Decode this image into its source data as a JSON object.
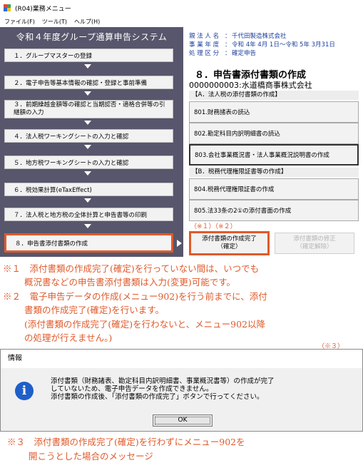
{
  "window": {
    "title": "(R04)業務メニュー",
    "icon_colors": [
      "#e0463a",
      "#3ea14a",
      "#2a6fd0",
      "#f2c21b"
    ]
  },
  "menubar": [
    "ファイル(F)",
    "ツール(T)",
    "ヘルプ(H)"
  ],
  "left_panel": {
    "title": "令和４年度グループ通算申告システム",
    "steps": [
      {
        "label": "１．グループマスターの登録"
      },
      {
        "label": "２．電子申告等基本情報の確認・登録と事前準備"
      },
      {
        "label": "３．前期繰越金額等の確認と当期認否・適格合併等の引継額の入力"
      },
      {
        "label": "４．法人税ワーキングシートの入力と確認"
      },
      {
        "label": "５．地方税ワーキングシートの入力と確認"
      },
      {
        "label": "６．税効果計算(eTaxEffect)"
      },
      {
        "label": "７．法人税と地方税の全体計算と申告書等の印刷"
      },
      {
        "label": "８．申告書添付書類の作成"
      }
    ]
  },
  "info": {
    "rows": [
      {
        "label": "親 法 人 名",
        "value": "千代田製造株式会社"
      },
      {
        "label": "事 業 年 度",
        "value": "令和 4年 4月 1日～令和 5年 3月31日"
      },
      {
        "label": "処 理 区 分",
        "value": "確定申告"
      }
    ]
  },
  "right_panel": {
    "title": "８．申告書添付書類の作成",
    "company": "0000000003:水道橋商事株式会社",
    "section1": "【A．法人税の添付書類の作成】",
    "buttons1": [
      "801.財務諸表の読込",
      "802.勘定科目内訳明細書の読込",
      "803.会社事業概況書・法人事業概況説明書の作成"
    ],
    "section2": "【B．税務代理権限証書等の作成】",
    "buttons2": [
      "804.税務代理権限証書の作成",
      "805.法33条の2①の添付書面の作成"
    ],
    "marks": "（※１）（※２）",
    "complete_line1": "添付書類の作成完了",
    "complete_line2": "（確定）",
    "fix_line1": "添付書類の修正",
    "fix_line2": "（確定解除）"
  },
  "notes": {
    "n1_line1": "※１　添付書類の作成完了(確定)を行っていない間は、いつでも",
    "n1_line2": "概況書などの申告書添付書類は入力(変更)可能です。",
    "n2_line1": "※２　電子申告データの作成(メニュー902)を行う前までに、添付",
    "n2_line2": "書類の作成完了(確定)を行います。",
    "n2_line3": "(添付書類の作成完了(確定)を行わないと、メニュー902以降",
    "n2_line4": "の処理が行えません。)",
    "n3_mark": "（※３）",
    "n3_line1": "※３　添付書類の作成完了(確定)を行わずにメニュー902を",
    "n3_line2": "開こうとした場合のメッセージ"
  },
  "dialog": {
    "title": "情報",
    "icon": "i",
    "msg1": "添付書類（財務諸表、勘定科目内訳明細書、事業概況書等）の作成が完了",
    "msg2": "していないため、電子申告データを作成できません。",
    "msg3": "添付書類の作成後、「添付書類の作成完了」ボタンで行ってください。",
    "ok": "OK"
  }
}
